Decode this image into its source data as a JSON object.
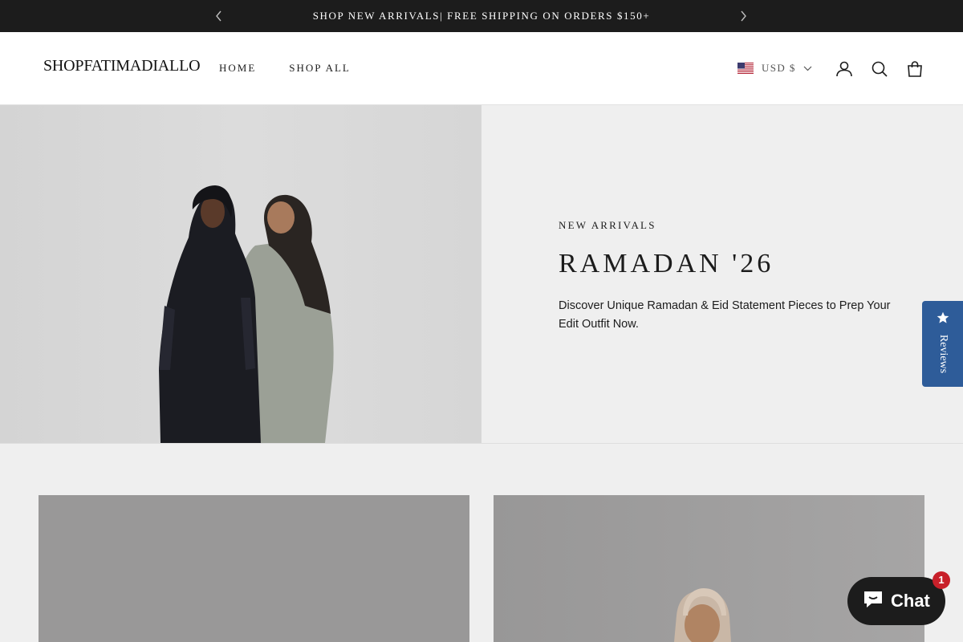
{
  "announcement": {
    "text": "SHOP NEW ARRIVALS| FREE SHIPPING ON ORDERS $150+",
    "prev_icon": "chevron-left-icon",
    "next_icon": "chevron-right-icon"
  },
  "header": {
    "logo": "SHOPFATIMADIALLO",
    "nav": [
      "HOME",
      "SHOP ALL"
    ],
    "currency": {
      "flag": "us-flag-icon",
      "label": "USD $"
    },
    "icons": [
      "account-icon",
      "search-icon",
      "cart-icon"
    ]
  },
  "hero": {
    "eyebrow": "NEW ARRIVALS",
    "title": "RAMADAN '26",
    "description": "Discover Unique Ramadan & Eid Statement Pieces to Prep Your Edit Outfit Now."
  },
  "reviews_tab": {
    "label": "Reviews",
    "color": "#2e5c99"
  },
  "chat": {
    "label": "Chat",
    "badge": "1",
    "badge_color": "#c8202a"
  },
  "colors": {
    "announcement_bg": "#1c1c1c",
    "page_bg": "#efefef",
    "text": "#1c1c1c"
  }
}
